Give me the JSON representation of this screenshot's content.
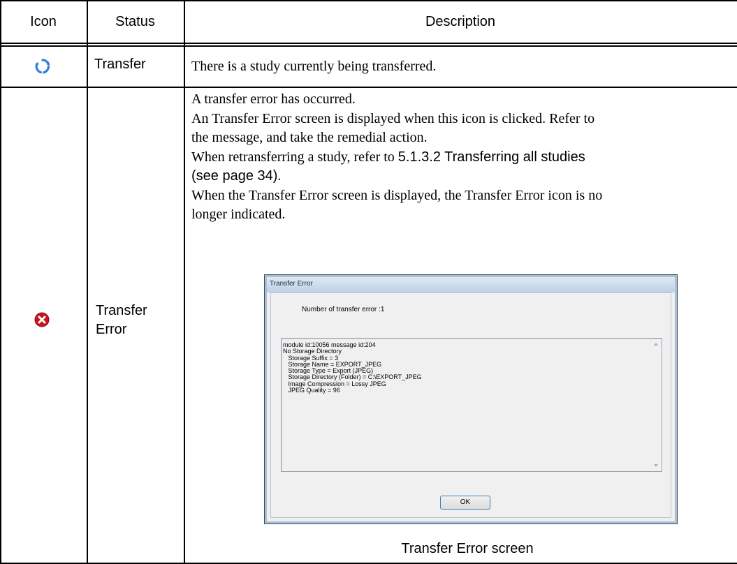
{
  "table": {
    "headers": {
      "icon": "Icon",
      "status": "Status",
      "description": "Description"
    },
    "rows": [
      {
        "icon": "transfer-icon",
        "status": "Transfer",
        "description": "There is a study currently being transferred."
      },
      {
        "icon": "error-icon",
        "status": [
          "Transfer",
          "Error"
        ],
        "description": {
          "line1": "A transfer error has occurred.",
          "line2a": "An Transfer Error screen is displayed when this icon is clicked. Refer to",
          "line2b": "the message, and take the remedial action.",
          "line3_prefix": "When retransferring a study, refer to ",
          "line3_link": "5.1.3.2 Transferring all studies",
          "line4_link": "(see page 34)",
          "line4_suffix": ".",
          "line5a": "When the Transfer Error screen is displayed, the Transfer Error icon is no",
          "line5b": "longer indicated."
        },
        "screenshot": {
          "title": "Transfer Error",
          "count_text": "Number of transfer error :1",
          "log_lines": [
            "module id:10056 message id:204",
            "No Storage Directory",
            "   Storage Suffix = 3",
            "   Storage Name = EXPORT_JPEG",
            "   Storage Type = Export (JPEG)",
            "   Storage Directory (Folder) = C:\\EXPORT_JPEG",
            "   Image Compression = Lossy JPEG",
            "   JPEG Quality = 96"
          ],
          "ok_label": "OK"
        },
        "caption": "Transfer Error screen"
      }
    ]
  },
  "colors": {
    "border": "#000000",
    "transfer_icon": "#2f7ee0",
    "error_icon": "#c8161d"
  }
}
